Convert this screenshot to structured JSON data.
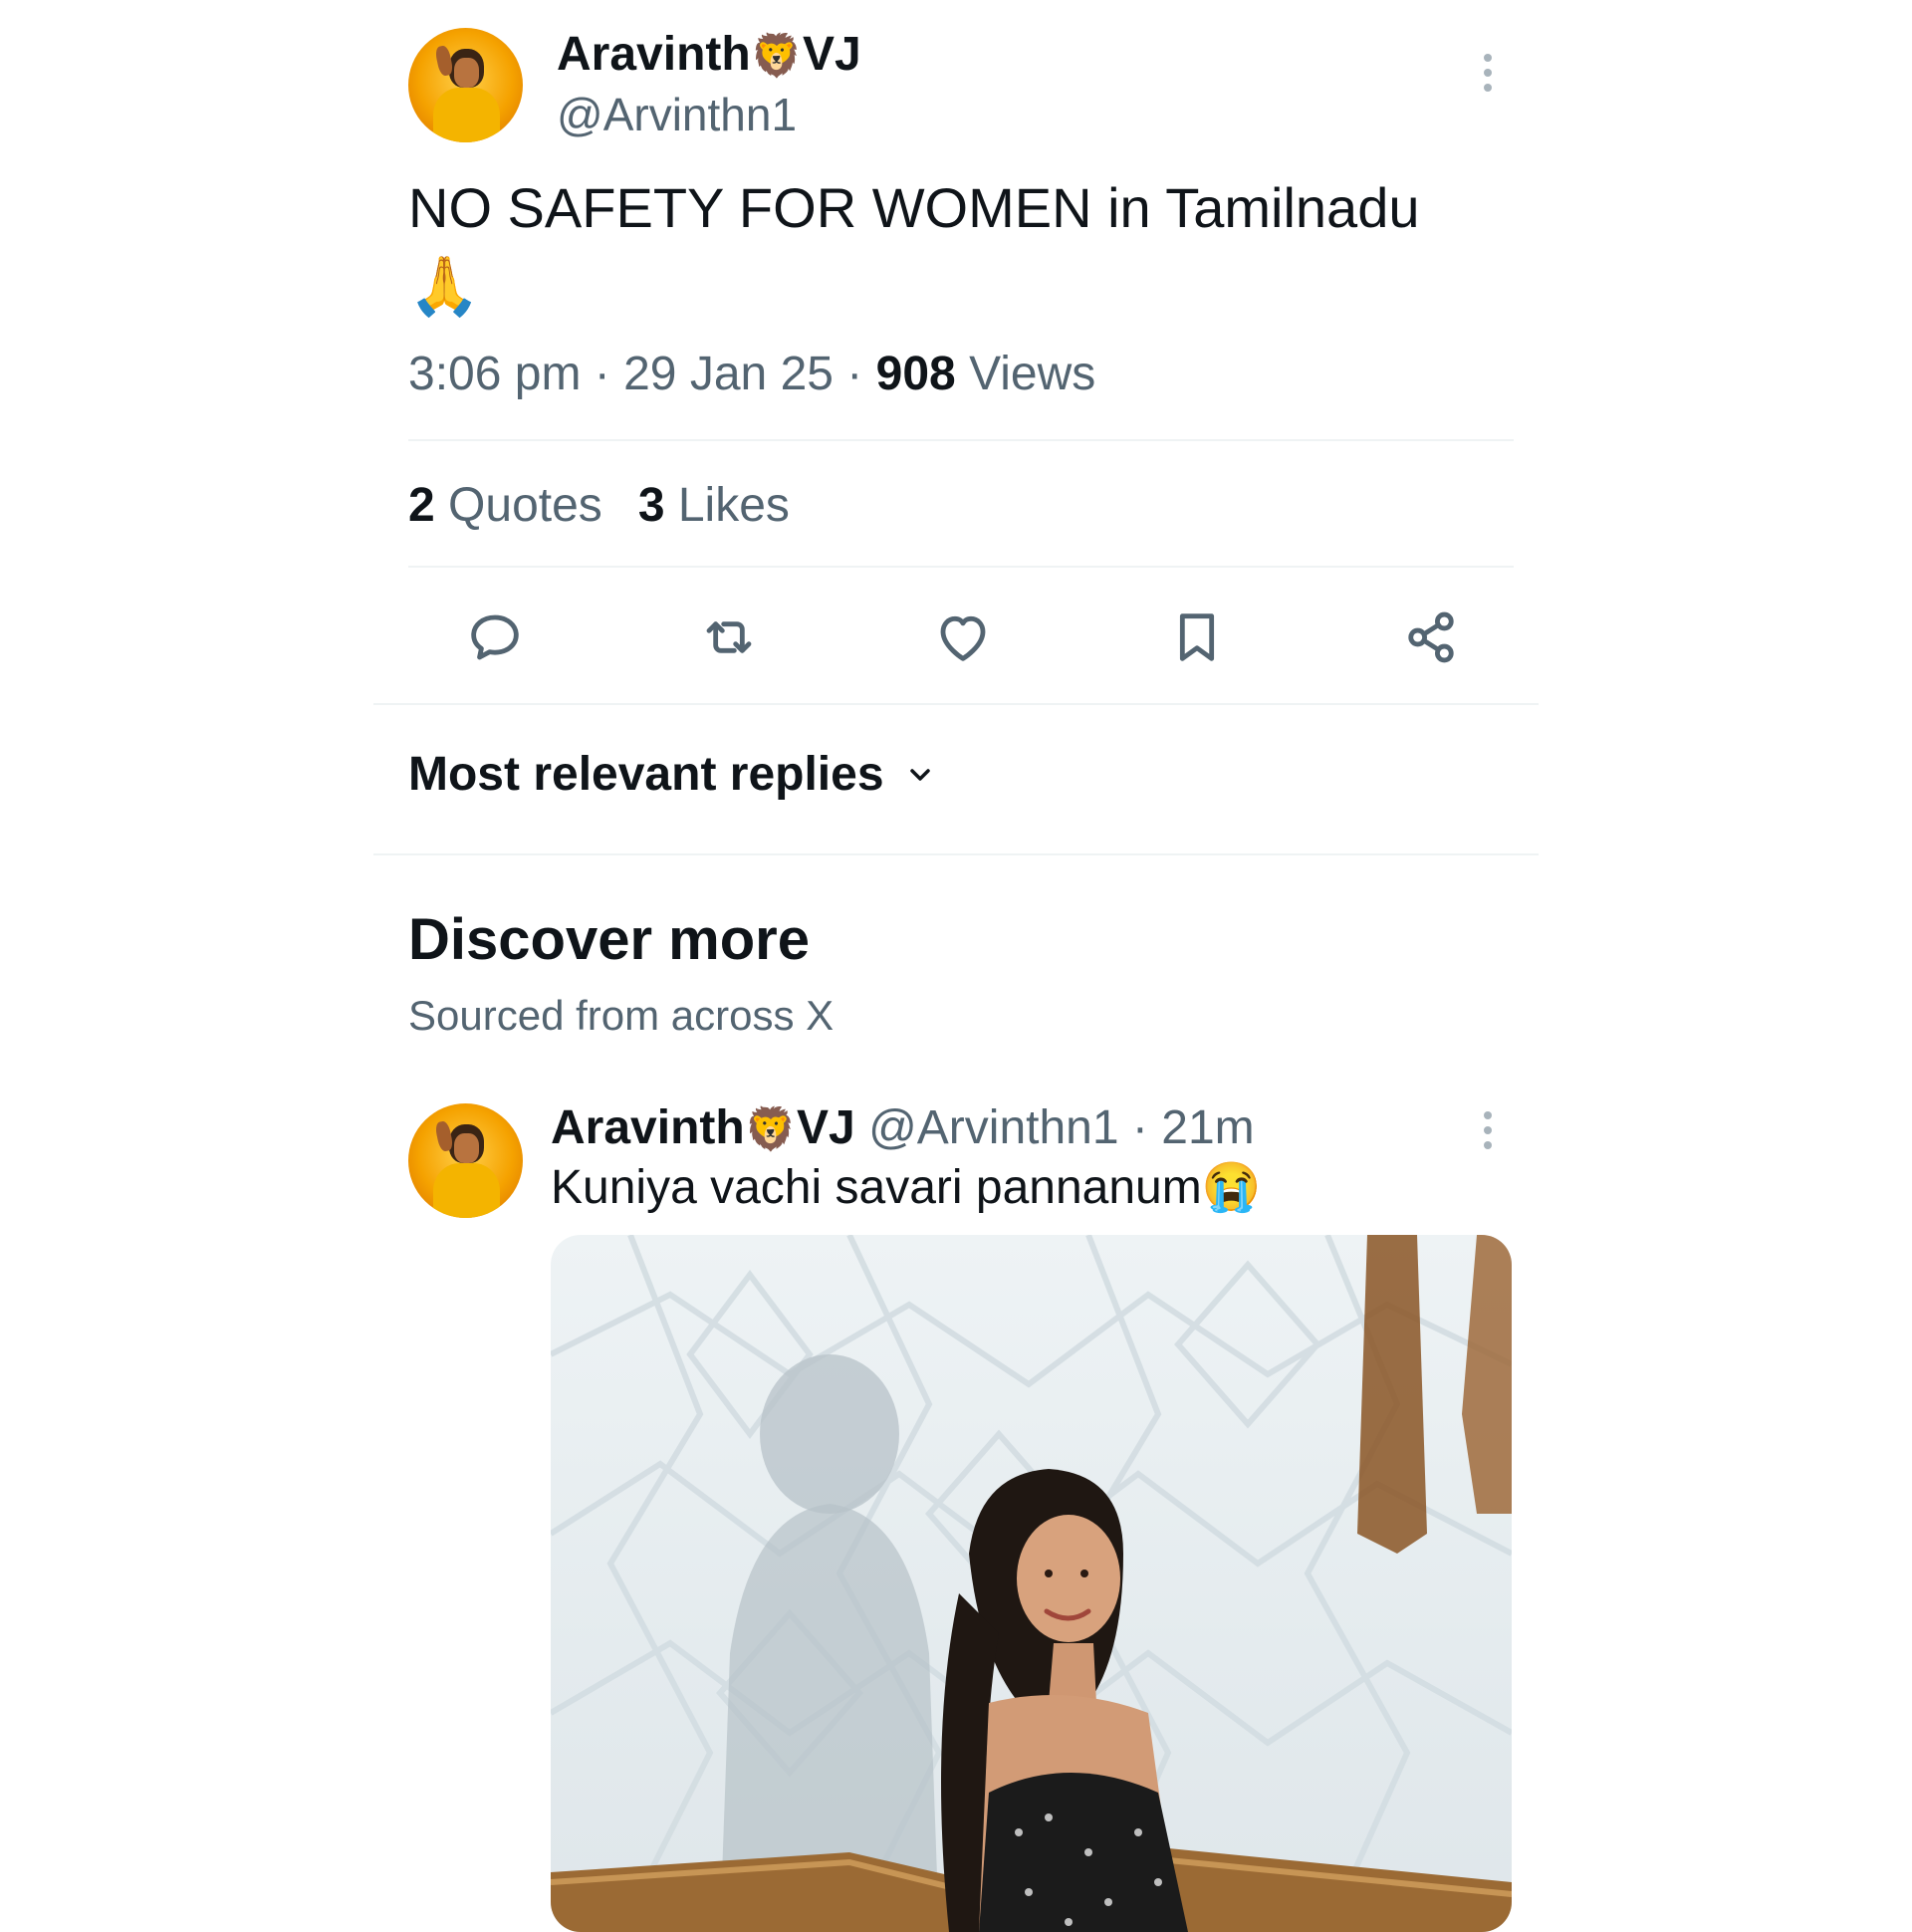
{
  "main_tweet": {
    "display_name": "Aravinth",
    "name_emoji": "🦁",
    "name_suffix": "VJ",
    "handle": "@Arvinthn1",
    "text": "NO SAFETY FOR WOMEN in Tamilnadu",
    "text_emoji": "🙏",
    "time": "3:06 pm",
    "date": "29 Jan 25",
    "views_count": "908",
    "views_label": "Views",
    "separator": "·",
    "quotes_count": "2",
    "quotes_label": "Quotes",
    "likes_count": "3",
    "likes_label": "Likes"
  },
  "actions": [
    "reply-icon",
    "retweet-icon",
    "like-icon",
    "bookmark-icon",
    "share-icon"
  ],
  "replies_sort": {
    "label": "Most relevant replies"
  },
  "discover": {
    "title": "Discover more",
    "subtitle": "Sourced from across X"
  },
  "discover_tweet": {
    "display_name": "Aravinth",
    "name_emoji": "🦁",
    "name_suffix": "VJ",
    "handle": "@Arvinthn1",
    "separator": "·",
    "age": "21m",
    "text": "Kuniya vachi savari pannanum",
    "text_emoji": "😭"
  },
  "colors": {
    "text_primary": "#0f1419",
    "text_secondary": "#536471",
    "divider": "#eff3f4",
    "icon": "#536471"
  }
}
